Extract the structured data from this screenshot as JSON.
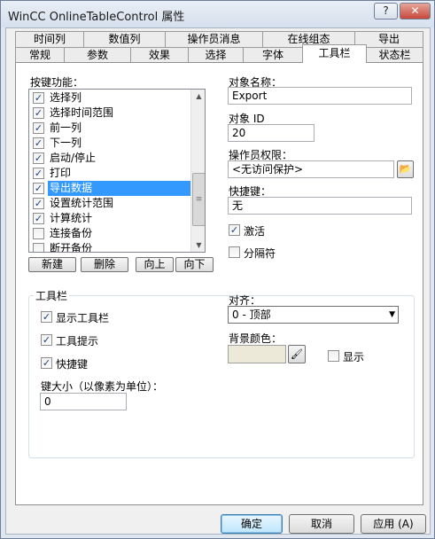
{
  "window": {
    "title": "WinCC OnlineTableControl 属性",
    "help_label": "?",
    "close_label": "✕"
  },
  "tabs_back": [
    "时间列",
    "数值列",
    "操作员消息",
    "在线组态",
    "导出"
  ],
  "tabs_front": [
    "常规",
    "参数",
    "效果",
    "选择",
    "字体",
    "工具栏",
    "状态栏"
  ],
  "functions": {
    "label": "按键功能：",
    "items": [
      {
        "label": "选择列",
        "checked": true
      },
      {
        "label": "选择时间范围",
        "checked": true
      },
      {
        "label": "前一列",
        "checked": true
      },
      {
        "label": "下一列",
        "checked": true
      },
      {
        "label": "启动/停止",
        "checked": true
      },
      {
        "label": "打印",
        "checked": true
      },
      {
        "label": "导出数据",
        "checked": true,
        "selected": true
      },
      {
        "label": "设置统计范围",
        "checked": true
      },
      {
        "label": "计算统计",
        "checked": true
      },
      {
        "label": "连接备份",
        "checked": false
      },
      {
        "label": "断开备份",
        "checked": false
      }
    ],
    "buttons": {
      "new": "新建",
      "delete": "删除",
      "up": "向上",
      "down": "向下"
    }
  },
  "object": {
    "name_label": "对象名称：",
    "name_value": "Export",
    "id_label": "对象 ID",
    "id_value": "20",
    "rights_label": "操作员权限：",
    "rights_value": "<无访问保护>",
    "shortcut_label": "快捷键：",
    "shortcut_value": "无",
    "active_label": "激活",
    "active_checked": true,
    "separator_label": "分隔符",
    "separator_checked": false
  },
  "toolbar_group": {
    "title": "工具栏",
    "show_toolbar": "显示工具栏",
    "tooltip": "工具提示",
    "hotkeys": "快捷键",
    "key_size_label": "键大小（以像素为单位）：",
    "key_size_value": "0",
    "align_label": "对齐：",
    "align_value": "0 - 顶部",
    "bg_color_label": "背景颜色：",
    "bg_color": "#ece9d8",
    "show_label": "显示",
    "show_checked": false
  },
  "footer": {
    "ok": "确定",
    "cancel": "取消",
    "apply": "应用 (A)"
  }
}
